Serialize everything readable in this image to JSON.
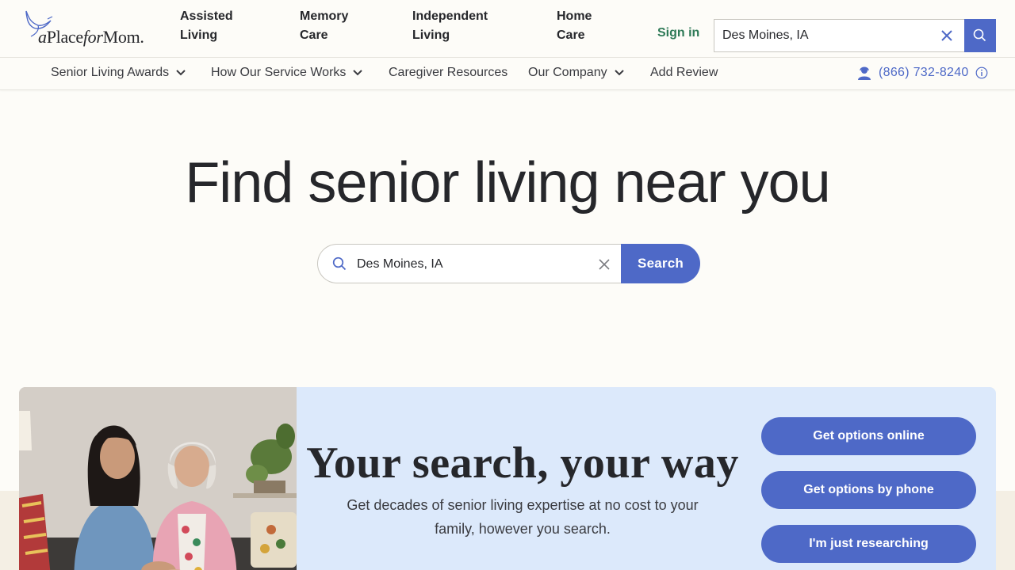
{
  "brand": {
    "logo_text_a": "a",
    "logo_text_place": "Place",
    "logo_text_for": "for",
    "logo_text_mom": "Mom",
    "logo_dot": "."
  },
  "header": {
    "nav": [
      {
        "line1": "Assisted",
        "line2": "Living"
      },
      {
        "line1": "Memory",
        "line2": "Care"
      },
      {
        "line1": "Independent",
        "line2": "Living"
      },
      {
        "line1": "Home",
        "line2": "Care"
      }
    ],
    "sign_in": "Sign in",
    "search_value": "Des Moines, IA"
  },
  "subnav": {
    "items": [
      {
        "label": "Senior Living Awards",
        "dropdown": true
      },
      {
        "label": "How Our Service Works",
        "dropdown": true
      },
      {
        "label": "Caregiver Resources",
        "dropdown": false
      },
      {
        "label": "Our Company",
        "dropdown": true
      },
      {
        "label": "Add Review",
        "dropdown": false
      }
    ],
    "phone": "(866) 732-8240"
  },
  "hero": {
    "title": "Find senior living near you",
    "search_value": "Des Moines, IA",
    "search_button": "Search"
  },
  "promo": {
    "title": "Your search, your way",
    "subtitle": "Get decades of senior living expertise at no cost to your family, however you search.",
    "buttons": [
      "Get options online",
      "Get options by phone",
      "I'm just researching"
    ]
  },
  "colors": {
    "accent": "#4e69c7",
    "sign_in": "#2e7a57",
    "card_bg": "#dce9fb",
    "page_bg": "#fdfcf8"
  },
  "icons": [
    "bird-logo-icon",
    "close-icon",
    "search-icon",
    "chevron-down-icon",
    "agent-icon",
    "info-icon"
  ]
}
